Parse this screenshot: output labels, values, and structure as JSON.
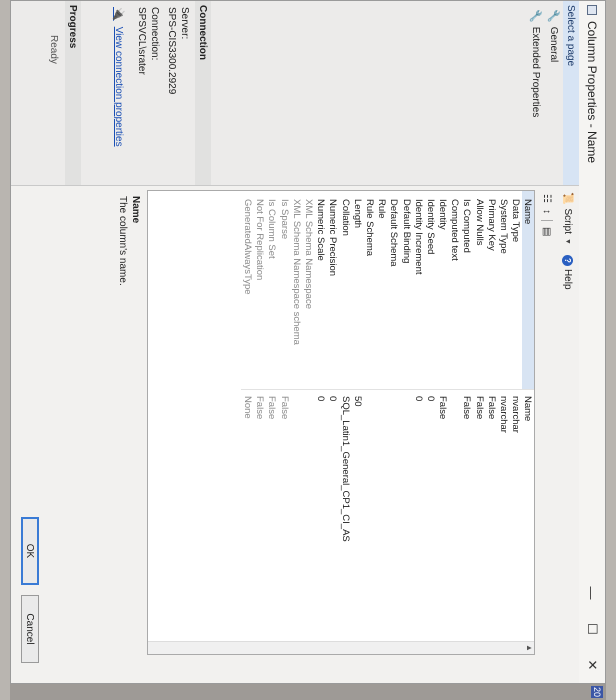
{
  "window": {
    "title": "Column Properties - Name",
    "controls": {
      "minimize": "—",
      "maximize": "☐",
      "close": "✕"
    }
  },
  "left_panel": {
    "select_page_header": "Select a page",
    "pages": [
      {
        "label": "General"
      },
      {
        "label": "Extended Properties"
      }
    ],
    "connection": {
      "header": "Connection",
      "server_label": "Server:",
      "server_value": "SPS-CIS3300.2929",
      "connection_label": "Connection:",
      "connection_value": "SPSVCL\\srater",
      "link": "View connection properties"
    },
    "progress": {
      "header": "Progress",
      "status": "Ready"
    }
  },
  "toolbar": {
    "script_label": "Script",
    "help_label": "Help"
  },
  "properties": [
    {
      "name": "Name",
      "value": "Name"
    },
    {
      "name": "Data Type",
      "value": "nvarchar"
    },
    {
      "name": "System Type",
      "value": "nvarchar"
    },
    {
      "name": "Primary Key",
      "value": "False"
    },
    {
      "name": "Allow Nulls",
      "value": "False"
    },
    {
      "name": "Is Computed",
      "value": "False"
    },
    {
      "name": "Computed text",
      "value": ""
    },
    {
      "name": "Identity",
      "value": "False"
    },
    {
      "name": "Identity Seed",
      "value": "0"
    },
    {
      "name": "Identity Increment",
      "value": "0"
    },
    {
      "name": "Default Binding",
      "value": ""
    },
    {
      "name": "Default Schema",
      "value": ""
    },
    {
      "name": "Rule",
      "value": ""
    },
    {
      "name": "Rule Schema",
      "value": ""
    },
    {
      "name": "Length",
      "value": "50"
    },
    {
      "name": "Collation",
      "value": "SQL_Latin1_General_CP1_CI_AS"
    },
    {
      "name": "Numeric Precision",
      "value": "0"
    },
    {
      "name": "Numeric Scale",
      "value": "0"
    },
    {
      "name": "XML Schema Namespace",
      "value": ""
    },
    {
      "name": "XML Schema Namespace schema",
      "value": ""
    },
    {
      "name": "Is Sparse",
      "value": "False"
    },
    {
      "name": "Is Column Set",
      "value": "False"
    },
    {
      "name": "Not For Replication",
      "value": "False"
    },
    {
      "name": "GeneratedAlwaysType",
      "value": "None"
    }
  ],
  "description": {
    "name": "Name",
    "text": "The column's name."
  },
  "buttons": {
    "ok": "OK",
    "cancel": "Cancel"
  },
  "edge_badge": "20"
}
